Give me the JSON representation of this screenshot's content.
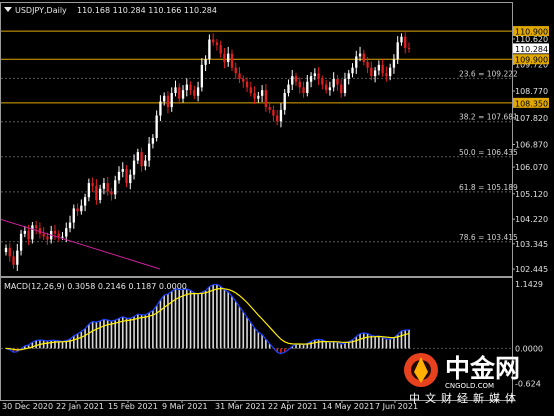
{
  "header": {
    "symbol": "USDJPY,Daily",
    "ohlc": "110.168 110.284 110.166 110.284"
  },
  "macd_header": "MACD(12,26,9) 0.3058 0.2146 0.1187 0.0000",
  "watermark": {
    "name": "中金网",
    "domain": "CNGOLD.COM",
    "tagline": "中文财经新媒体"
  },
  "colors": {
    "background": "#000000",
    "bull": "#ffffff",
    "bear": "#e02020",
    "level_line": "#e0a800",
    "grid": "#5a5a5a",
    "trendline": "#c8209a",
    "macd_line": "#1e40ff",
    "signal_line": "#ffee00",
    "hist_pos": "#d8d8d8",
    "hist_neg": "#e02020"
  },
  "chart_data": [
    {
      "type": "candlestick",
      "title": "USDJPY,Daily",
      "y_axis_ticks": [
        110.62,
        109.72,
        108.77,
        107.82,
        106.87,
        106.07,
        105.12,
        104.22,
        103.345,
        102.445
      ],
      "ylim": [
        102.2,
        111.4
      ],
      "x_axis_ticks": [
        "30 Dec 2020",
        "22 Jan 2021",
        "15 Feb 2021",
        "9 Mar 2021",
        "31 Mar 2021",
        "22 Apr 2021",
        "14 May 2021",
        "7 Jun 2021"
      ],
      "price_labels": [
        {
          "value": 110.9,
          "label": "110.900",
          "style": "boxed"
        },
        {
          "value": 110.284,
          "label": "110.284",
          "style": "current"
        },
        {
          "value": 109.9,
          "label": "109.900",
          "style": "boxed"
        },
        {
          "value": 108.35,
          "label": "108.350",
          "style": "boxed"
        }
      ],
      "horizontal_levels": [
        110.9,
        109.9,
        108.35
      ],
      "fibonacci_levels": [
        {
          "value": 109.222,
          "label": "23.6 = 109.222"
        },
        {
          "value": 107.681,
          "label": "38.2 = 107.681"
        },
        {
          "value": 106.435,
          "label": "50.0 = 106.435"
        },
        {
          "value": 105.189,
          "label": "61.8 = 105.189"
        },
        {
          "value": 103.415,
          "label": "78.6 = 103.415"
        }
      ],
      "closes": [
        103.2,
        102.9,
        102.6,
        103.1,
        103.7,
        103.8,
        103.5,
        104.0,
        103.9,
        103.7,
        103.6,
        103.5,
        103.8,
        103.7,
        103.6,
        103.6,
        103.9,
        104.1,
        104.6,
        104.5,
        104.7,
        105.0,
        105.5,
        105.4,
        104.9,
        105.3,
        105.5,
        105.2,
        105.1,
        105.6,
        105.9,
        106.0,
        105.5,
        105.8,
        106.3,
        106.6,
        106.1,
        106.3,
        106.9,
        107.1,
        107.9,
        108.4,
        108.6,
        108.2,
        108.7,
        108.9,
        108.5,
        108.8,
        109.0,
        108.8,
        108.6,
        108.9,
        109.7,
        109.9,
        110.6,
        110.5,
        110.4,
        110.1,
        109.8,
        110.1,
        109.6,
        109.4,
        109.2,
        109.1,
        108.9,
        108.7,
        108.5,
        108.6,
        108.8,
        108.2,
        108.1,
        107.9,
        107.7,
        108.1,
        108.7,
        109.0,
        109.3,
        109.1,
        108.9,
        108.7,
        109.1,
        109.3,
        109.4,
        109.2,
        109.0,
        108.8,
        108.9,
        109.2,
        109.0,
        108.7,
        109.2,
        109.4,
        109.6,
        110.0,
        110.1,
        109.8,
        109.6,
        109.3,
        109.5,
        109.7,
        109.4,
        109.3,
        109.6,
        109.9,
        110.5,
        110.7,
        110.3,
        110.28
      ]
    },
    {
      "type": "macd",
      "title": "MACD(12,26,9) 0.3058 0.2146 0.1187 0.0000",
      "params": [
        12,
        26,
        9
      ],
      "values": {
        "macd": 0.3058,
        "signal": 0.2146,
        "histogram": 0.1187,
        "zero": 0.0
      },
      "y_axis_ticks": [
        1.1429,
        0.0,
        -0.624
      ],
      "ylim": [
        -0.9,
        1.2
      ],
      "series": [
        {
          "name": "MACD",
          "role": "macd_line"
        },
        {
          "name": "Signal",
          "role": "signal_line"
        }
      ]
    }
  ]
}
